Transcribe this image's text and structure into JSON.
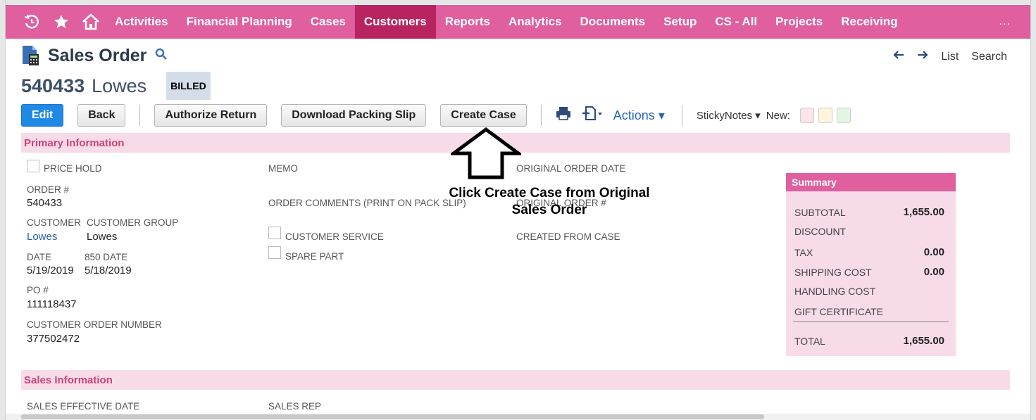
{
  "nav": {
    "icons": [
      "recent-icon",
      "star-icon",
      "home-icon"
    ],
    "items": [
      {
        "label": "Activities"
      },
      {
        "label": "Financial Planning"
      },
      {
        "label": "Cases"
      },
      {
        "label": "Customers"
      },
      {
        "label": "Reports"
      },
      {
        "label": "Analytics"
      },
      {
        "label": "Documents"
      },
      {
        "label": "Setup"
      },
      {
        "label": "CS - All"
      },
      {
        "label": "Projects"
      },
      {
        "label": "Receiving"
      }
    ],
    "more": "...",
    "active": "Customers",
    "colors": {
      "bar": "#df5f9f",
      "active": "#b8245f"
    }
  },
  "header": {
    "title": "Sales Order",
    "record_id": "540433",
    "record_name": "Lowes",
    "status": "BILLED",
    "right_links": {
      "list": "List",
      "search": "Search"
    }
  },
  "toolbar": {
    "edit": "Edit",
    "back": "Back",
    "authorize_return": "Authorize Return",
    "download_packing_slip": "Download Packing Slip",
    "create_case": "Create Case",
    "actions": "Actions",
    "sticky_notes": "StickyNotes",
    "new": "New:",
    "note_colors": [
      "#fce4ea",
      "#fdf6dc",
      "#e2f7e3"
    ]
  },
  "primary": {
    "section_title": "Primary Information",
    "price_hold": "PRICE HOLD",
    "order_no_label": "ORDER #",
    "order_no": "540433",
    "customer_label": "CUSTOMER",
    "customer": "Lowes",
    "customer_group_label": "CUSTOMER GROUP",
    "customer_group": "Lowes",
    "date_label": "DATE",
    "date": "5/19/2019",
    "date_850_label": "850 DATE",
    "date_850": "5/18/2019",
    "po_label": "PO #",
    "po": "111118437",
    "customer_order_number_label": "CUSTOMER ORDER NUMBER",
    "customer_order_number": "377502472",
    "memo_label": "MEMO",
    "order_comments_label": "ORDER COMMENTS (PRINT ON PACK SLIP)",
    "customer_service_label": "CUSTOMER SERVICE",
    "spare_part_label": "SPARE PART",
    "original_order_date_label": "ORIGINAL ORDER DATE",
    "original_order_no_label": "ORIGINAL ORDER #",
    "created_from_case_label": "CREATED FROM CASE"
  },
  "summary": {
    "title": "Summary",
    "subtotal_label": "SUBTOTAL",
    "subtotal": "1,655.00",
    "discount_label": "DISCOUNT",
    "tax_label": "TAX",
    "tax": "0.00",
    "shipping_label": "SHIPPING COST",
    "shipping": "0.00",
    "handling_label": "HANDLING COST",
    "gift_label": "GIFT CERTIFICATE",
    "total_label": "TOTAL",
    "total": "1,655.00"
  },
  "sales": {
    "section_title": "Sales Information",
    "sales_effective_date_label": "SALES EFFECTIVE DATE",
    "sales_rep_label": "SALES REP"
  },
  "annotation": {
    "line1": "Click Create Case from Original",
    "line2": "Sales Order"
  }
}
